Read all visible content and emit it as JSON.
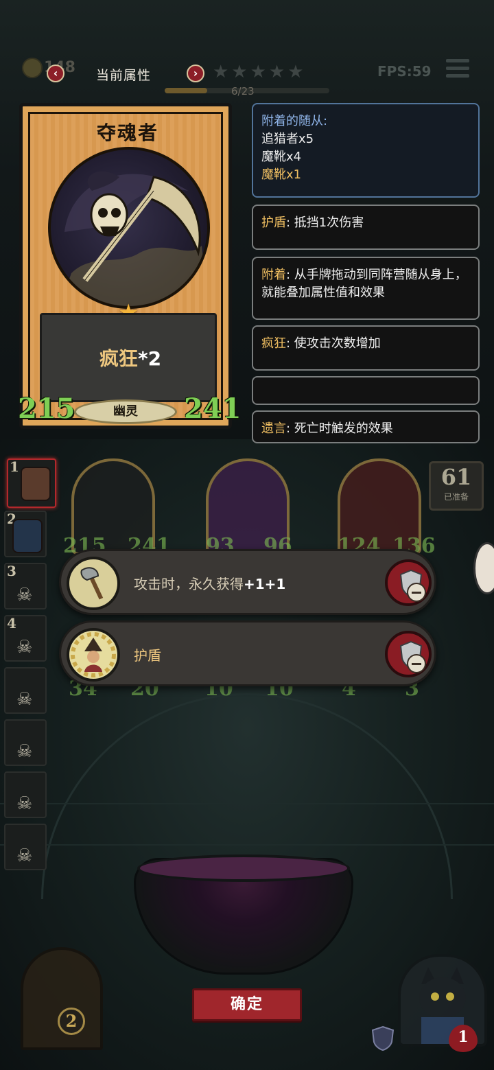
{
  "hud": {
    "gold": "148",
    "fps_label": "FPS:59",
    "panel_title": "当前属性",
    "prev_label": "‹",
    "next_label": "›",
    "stars": "★★★★★",
    "progress": "6/23",
    "progress_fraction": 0.26
  },
  "card": {
    "name": "夺魂者",
    "keyword": "疯狂",
    "keyword_mult": "*2",
    "attack": "215",
    "health": "241",
    "tribe": "幽灵",
    "star": "★"
  },
  "info": {
    "attached_title": "附着的随从:",
    "attached": [
      {
        "text": "追猎者x5"
      },
      {
        "text": "魔靴x4"
      },
      {
        "text": "魔靴x1"
      }
    ],
    "panels": [
      {
        "keyword": "护盾",
        "text": ": 抵挡1次伤害"
      },
      {
        "keyword": "附着",
        "text": ": 从手牌拖动到同阵营随从身上，就能叠加属性值和效果"
      },
      {
        "keyword": "疯狂",
        "text": ": 使攻击次数增加"
      },
      {
        "keyword": "遗言",
        "text": ": 死亡时触发的效果"
      }
    ]
  },
  "roster": [
    "1",
    "2",
    "3",
    "4"
  ],
  "board": {
    "cards": [
      {
        "attack": "34",
        "health": "20",
        "top_attack": "215",
        "top_health": "241"
      },
      {
        "attack": "10",
        "health": "10",
        "top_attack": "93",
        "top_health": "96"
      },
      {
        "attack": "4",
        "health": "3",
        "top_attack": "124",
        "top_health": "136"
      }
    ],
    "deck_count": "61",
    "deck_label": "已准备"
  },
  "buffs": [
    {
      "prefix": "攻击时，永久获得",
      "value": "+1+1",
      "icon": "axe-icon"
    },
    {
      "prefix": "护盾",
      "value": "",
      "icon": "witch-icon"
    }
  ],
  "confirm_label": "确定",
  "bottom": {
    "door_count": "2",
    "lives": "1"
  },
  "colors": {
    "accent_red": "#a0262c",
    "keyword_gold": "#f0bf62",
    "stat_green": "#7fcf55"
  }
}
